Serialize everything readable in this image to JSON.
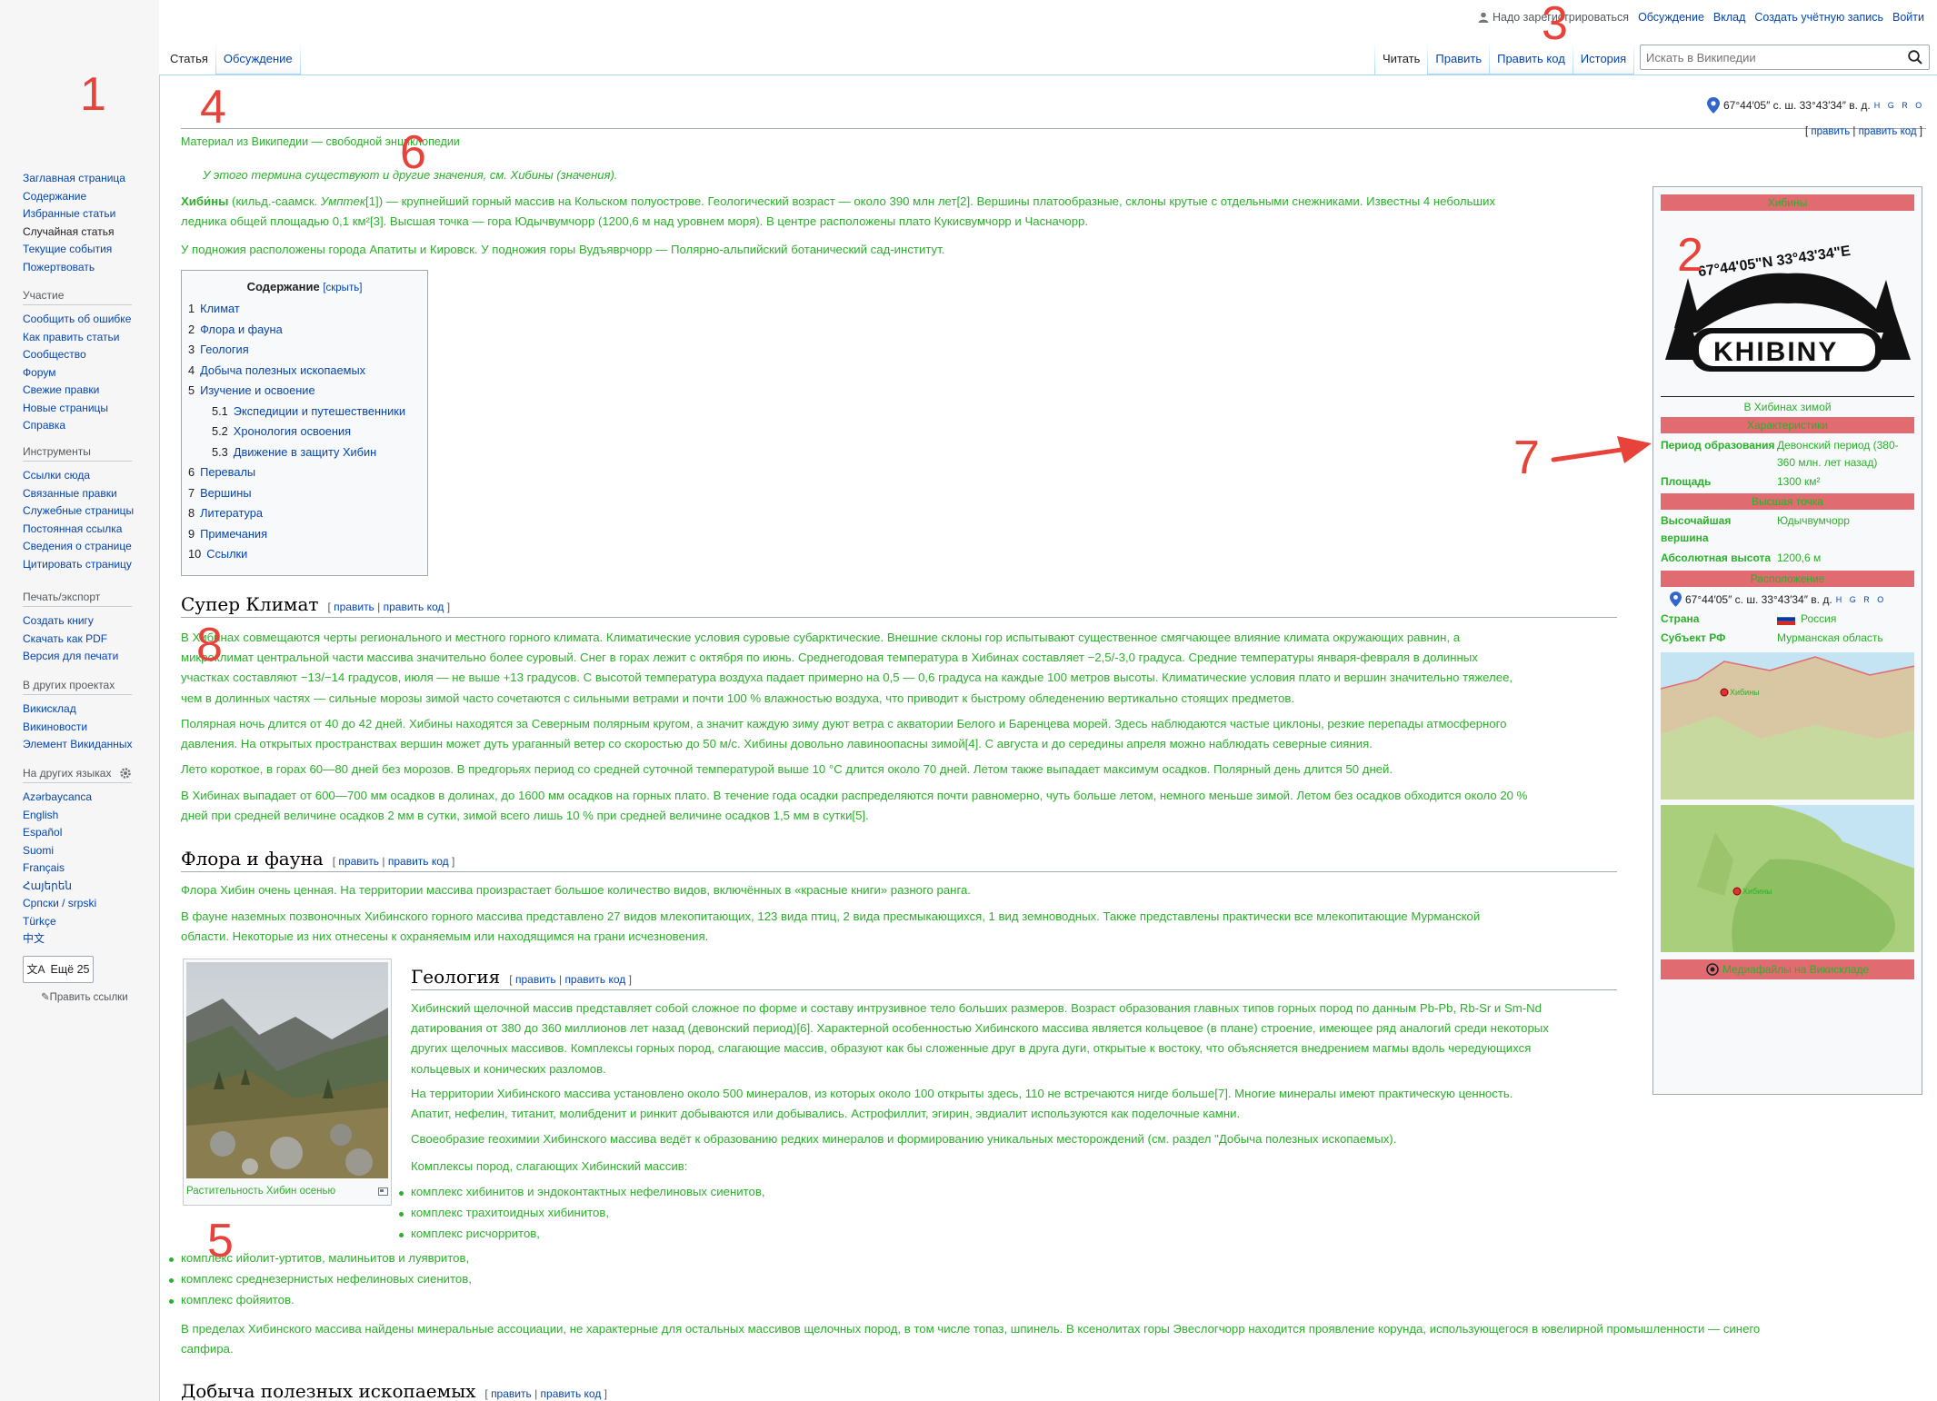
{
  "markers": [
    "1",
    "2",
    "3",
    "4",
    "5",
    "6",
    "7",
    "8"
  ],
  "personal": {
    "not_logged": "Надо зарегистрироваться",
    "talk": "Обсуждение",
    "contrib": "Вклад",
    "create_account": "Создать учётную запись",
    "login": "Войти"
  },
  "tabs_left": [
    "Статья",
    "Обсуждение"
  ],
  "tabs_right": [
    "Читать",
    "Править",
    "Править код",
    "История"
  ],
  "search": {
    "placeholder": "Искать в Википедии"
  },
  "sidebar": {
    "nav": [
      "Заглавная страница",
      "Содержание",
      "Избранные статьи",
      "Случайная статья",
      "Текущие события",
      "Пожертвовать"
    ],
    "participation_title": "Участие",
    "participation": [
      "Сообщить об ошибке",
      "Как править статьи",
      "Сообщество",
      "Форум",
      "Свежие правки",
      "Новые страницы",
      "Справка"
    ],
    "tools_title": "Инструменты",
    "tools": [
      "Ссылки сюда",
      "Связанные правки",
      "Служебные страницы",
      "Постоянная ссылка",
      "Сведения о странице",
      "Цитировать страницу"
    ],
    "print_title": "Печать/экспорт",
    "print": [
      "Создать книгу",
      "Скачать как PDF",
      "Версия для печати"
    ],
    "projects_title": "В других проектах",
    "projects": [
      "Викисклад",
      "Викиновости",
      "Элемент Викиданных"
    ],
    "languages_title": "На других языках",
    "languages": [
      "Azərbaycanca",
      "English",
      "Español",
      "Suomi",
      "Français",
      "Հայերեն",
      "Српски / srpski",
      "Türkçe",
      "中文"
    ],
    "more_langs": "Ещё 25",
    "edit_links": "Править ссылки"
  },
  "coords": {
    "text": "67°44′05″ с. ш. 33°43′34″ в. д.",
    "suffix": "H G R O"
  },
  "edit_links": {
    "edit": "править",
    "edit_code": "править код"
  },
  "from_wiki": "Материал из Википедии — свободной энциклопедии",
  "hatnote": "У этого термина существуют и другие значения, см. Хибины (значения).",
  "intro": {
    "p1_bold": "Хиби́ны",
    "p1a": " (кильд.-саамск. ",
    "p1_italic": "Умптек",
    "p1b": "[1]) — крупнейший горный массив на Кольском полуострове. Геологический возраст — около 390 млн лет[2]. Вершины платообразные, склоны крутые с отдельными снежниками. Известны 4 небольших",
    "p1c": "ледника общей площадью 0,1 км²[3]. Высшая точка — гора Юдычвумчорр (1200,6 м над уровнем моря). В центре расположены плато Кукисвумчорр и Часначорр.",
    "p2": "У подножия расположены города Апатиты и Кировск. У подножия горы Вудъяврчорр — Полярно-альпийский ботанический сад-институт."
  },
  "toc": {
    "title": "Содержание",
    "toggle": "[скрыть]",
    "items": [
      {
        "num": "1",
        "label": "Климат",
        "lvl": 1
      },
      {
        "num": "2",
        "label": "Флора и фауна",
        "lvl": 1
      },
      {
        "num": "3",
        "label": "Геология",
        "lvl": 1
      },
      {
        "num": "4",
        "label": "Добыча полезных ископаемых",
        "lvl": 1
      },
      {
        "num": "5",
        "label": "Изучение и освоение",
        "lvl": 1
      },
      {
        "num": "5.1",
        "label": "Экспедиции и путешественники",
        "lvl": 2
      },
      {
        "num": "5.2",
        "label": "Хронология освоения",
        "lvl": 2
      },
      {
        "num": "5.3",
        "label": "Движение в защиту Хибин",
        "lvl": 2
      },
      {
        "num": "6",
        "label": "Перевалы",
        "lvl": 1
      },
      {
        "num": "7",
        "label": "Вершины",
        "lvl": 1
      },
      {
        "num": "8",
        "label": "Литература",
        "lvl": 1
      },
      {
        "num": "9",
        "label": "Примечания",
        "lvl": 1
      },
      {
        "num": "10",
        "label": "Ссылки",
        "lvl": 1
      }
    ]
  },
  "climate": {
    "heading": "Супер Климат",
    "p1": [
      "В Хибинах совмещаются черты регионального и местного горного климата. Климатические условия суровые субарктические. Внешние склоны гор испытывают существенное смягчающее влияние климата окружающих равнин, а",
      "микроклимат центральной части массива значительно более суровый. Снег в горах лежит с октября по июнь. Среднегодовая температура в Хибинах составляет −2,5/-3,0 градуса. Средние температуры января-февраля в долинных",
      "участках составляют −13/−14 градусов, июля — не выше +13 градусов. С высотой температура воздуха падает примерно на 0,5 — 0,6 градуса на каждые 100 метров высоты. Климатические условия плато и вершин значительно тяжелее,",
      "чем в долинных частях — сильные морозы зимой часто сочетаются с сильными ветрами и почти 100 % влажностью воздуха, что приводит к быстрому обледенению вертикально стоящих предметов."
    ],
    "p2": [
      "Полярная ночь длится от 40 до 42 дней. Хибины находятся за Северным полярным кругом, а значит каждую зиму дуют ветра с акватории Белого и Баренцева морей. Здесь наблюдаются частые циклоны, резкие перепады атмосферного",
      "давления. На открытых пространствах вершин может дуть ураганный ветер со скоростью до 50 м/с. Хибины довольно лавиноопасны зимой[4]. С августа и до середины апреля можно наблюдать северные сияния."
    ],
    "p3": "Лето короткое, в горах 60—80 дней без морозов. В предгорьях период со средней суточной температурой выше 10 °C длится около 70 дней. Летом также выпадает максимум осадков. Полярный день длится 50 дней.",
    "p4": [
      "В Хибинах выпадает от 600—700 мм осадков в долинах, до 1600 мм осадков на горных плато. В течение года осадки распределяются почти равномерно, чуть больше летом, немного меньше зимой. Летом без осадков обходится около 20 %",
      "дней при средней величине осадков 2 мм в сутки, зимой всего лишь 10 % при средней величине осадков 1,5 мм в сутки[5]."
    ]
  },
  "flora": {
    "heading": "Флора и фауна",
    "p1": "Флора Хибин очень ценная. На территории массива произрастает большое количество видов, включённых в «красные книги» разного ранга.",
    "p2": [
      "В фауне наземных позвоночных Хибинского горного массива представлено 27 видов млекопитающих, 123 вида птиц, 2 вида пресмыкающихся, 1 вид земноводных. Также представлены практически все млекопитающие Мурманской",
      "области. Некоторые из них отнесены к охраняемым или находящимся на грани исчезновения."
    ]
  },
  "thumb": {
    "caption": "Растительность Хибин осенью"
  },
  "geology": {
    "heading": "Геология",
    "p1": [
      "Хибинский щелочной массив представляет собой сложное по форме и составу интрузивное тело больших размеров. Возраст образования главных типов горных пород по данным Pb-Pb, Rb-Sr и Sm-Nd",
      "датирования от 380 до 360 миллионов лет назад (девонский период)[6]. Характерной особенностью Хибинского массива является кольцевое (в плане) строение, имеющее ряд аналогий среди некоторых",
      "других щелочных массивов. Комплексы горных пород, слагающие массив, образуют как бы сложенные друг в друга дуги, открытые к востоку, что объясняется внедрением магмы вдоль чередующихся",
      "кольцевых и конических разломов."
    ],
    "p2": [
      "На территории Хибинского массива установлено около 500 минералов, из которых около 100 открыты здесь, 110 не встречаются нигде больше[7]. Многие минералы имеют практическую ценность.",
      "Апатит, нефелин, титанит, молибденит и ринкит добываются или добывались. Астрофиллит, эгирин, эвдиалит используются как поделочные камни."
    ],
    "p3": "Своеобразие геохимии Хибинского массива ведёт к образованию редких минералов и формированию уникальных месторождений (см. раздел \"Добыча полезных ископаемых).",
    "p4": "Комплексы пород, слагающих Хибинский массив:",
    "list": [
      "комплекс хибинитов и эндоконтактных нефелиновых сиенитов,",
      "комплекс трахитоидных хибинитов,",
      "комплекс рисчорритов,",
      "комплекс ийолит-уртитов, малиньитов и луявритов,",
      "комплекс среднезернистых нефелиновых сиенитов,",
      "комплекс фойяитов."
    ],
    "p5": [
      "В пределах Хибинского массива найдены минеральные ассоциации, не характерные для остальных массивов щелочных пород, в том числе топаз, шпинель. В ксенолитах горы Эвеслогчорр находится проявление корунда, использующегося в ювелирной промышленности — синего",
      "сапфира."
    ]
  },
  "mining": {
    "heading": "Добыча полезных ископаемых"
  },
  "infobox": {
    "title": "Хибины",
    "logo_arc": "67°44'05\"N 33°43'34\"E",
    "logo_word": "KHIBINY",
    "image_caption": "В Хибинах зимой",
    "h_char": "Характеристики",
    "period_k": "Период образования",
    "period_v": "Девонский период (380-360 млн. лет назад)",
    "area_k": "Площадь",
    "area_v": "1300 км²",
    "h_peak": "Высшая точка",
    "peak_k": "Высочайшая вершина",
    "peak_v": "Юдычвумчорр",
    "height_k": "Абсолютная высота",
    "height_v": "1200,6 м",
    "h_loc": "Расположение",
    "country_k": "Страна",
    "country_v": "Россия",
    "subject_k": "Субъект РФ",
    "subject_v": "Мурманская область",
    "map_label": "Хибины",
    "commons": "Медиафайлы на Викискладе"
  },
  "colors": {
    "accent_link": "#0645ad",
    "marker_red": "#e8433a",
    "green_text": "#2bb02b",
    "infobox_bar": "#e06b70"
  }
}
